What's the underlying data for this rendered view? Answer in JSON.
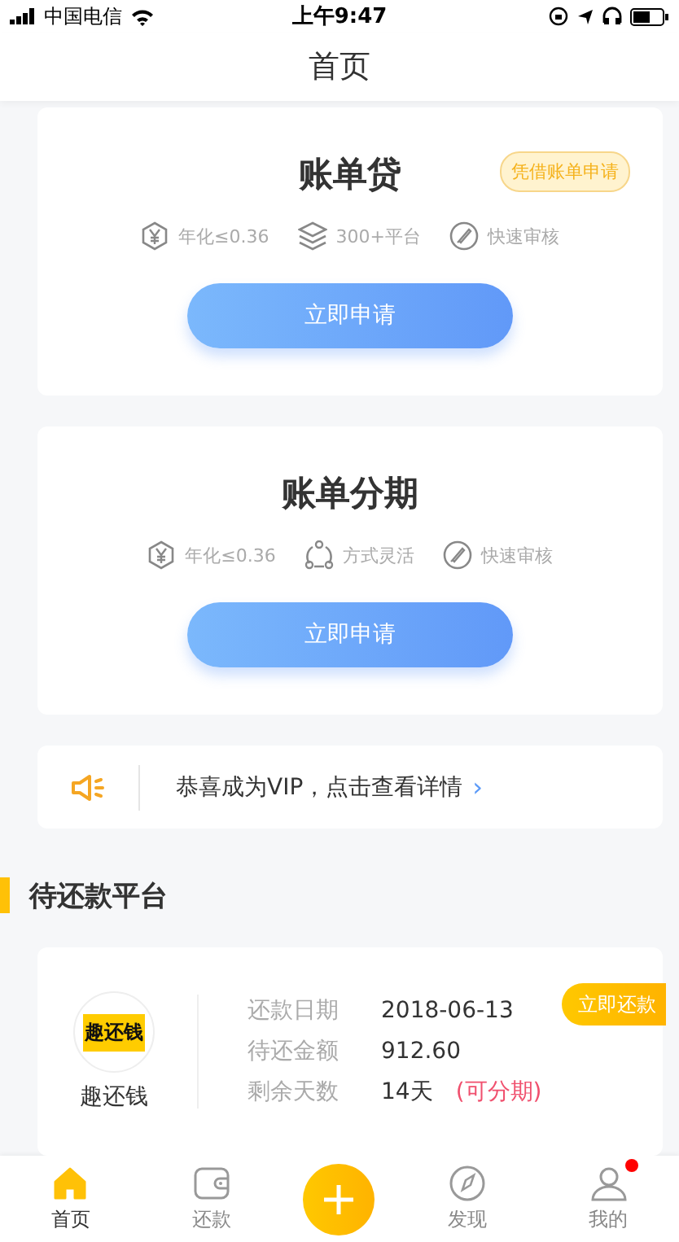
{
  "status_bar": {
    "carrier": "中国电信",
    "time": "上午9:47"
  },
  "header": {
    "title": "首页"
  },
  "products": [
    {
      "title": "账单贷",
      "tag": "凭借账单申请",
      "features": [
        {
          "kind": "yen",
          "label": "年化≤0.36"
        },
        {
          "kind": "layers",
          "label": "300+平台"
        },
        {
          "kind": "rocket",
          "label": "快速审核"
        }
      ],
      "button": "立即申请"
    },
    {
      "title": "账单分期",
      "features": [
        {
          "kind": "yen",
          "label": "年化≤0.36"
        },
        {
          "kind": "nodes",
          "label": "方式灵活"
        },
        {
          "kind": "rocket",
          "label": "快速审核"
        }
      ],
      "button": "立即申请"
    }
  ],
  "notice": {
    "text": "恭喜成为VIP，点击查看详情",
    "arrow": "›"
  },
  "section": {
    "title": "待还款平台"
  },
  "platform": {
    "logo_text": "趣还钱",
    "name": "趣还钱",
    "rows": [
      {
        "label": "还款日期",
        "value": "2018-06-13"
      },
      {
        "label": "待还金额",
        "value": "912.60"
      },
      {
        "label": "剩余天数",
        "value": "14天",
        "note": "(可分期)"
      }
    ],
    "button": "立即还款"
  },
  "tabs": [
    {
      "kind": "tab",
      "label": "首页",
      "selected": true,
      "badge": false
    },
    {
      "kind": "tab",
      "label": "还款",
      "selected": false,
      "badge": false
    },
    {
      "kind": "add",
      "selected": false
    },
    {
      "kind": "tab",
      "label": "发现",
      "selected": false,
      "badge": false
    },
    {
      "kind": "tab",
      "label": "我的",
      "selected": false,
      "badge": true
    }
  ]
}
